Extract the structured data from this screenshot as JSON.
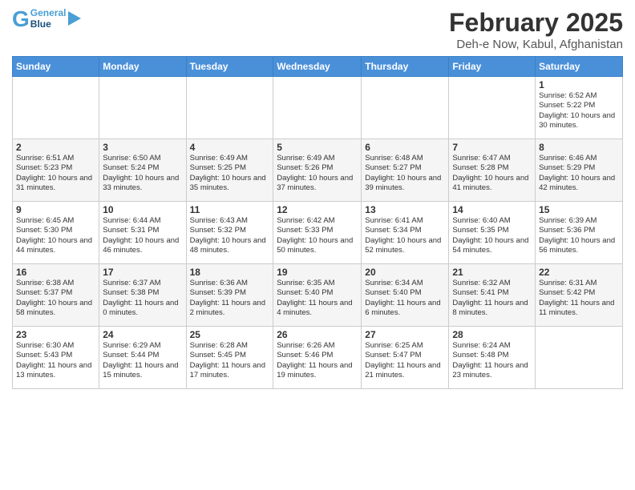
{
  "app": {
    "logo_general": "General",
    "logo_blue": "Blue",
    "title": "February 2025",
    "location": "Deh-e Now, Kabul, Afghanistan"
  },
  "calendar": {
    "headers": [
      "Sunday",
      "Monday",
      "Tuesday",
      "Wednesday",
      "Thursday",
      "Friday",
      "Saturday"
    ],
    "weeks": [
      {
        "days": [
          {
            "num": "",
            "info": ""
          },
          {
            "num": "",
            "info": ""
          },
          {
            "num": "",
            "info": ""
          },
          {
            "num": "",
            "info": ""
          },
          {
            "num": "",
            "info": ""
          },
          {
            "num": "",
            "info": ""
          },
          {
            "num": "1",
            "info": "Sunrise: 6:52 AM\nSunset: 5:22 PM\nDaylight: 10 hours and 30 minutes."
          }
        ]
      },
      {
        "days": [
          {
            "num": "2",
            "info": "Sunrise: 6:51 AM\nSunset: 5:23 PM\nDaylight: 10 hours and 31 minutes."
          },
          {
            "num": "3",
            "info": "Sunrise: 6:50 AM\nSunset: 5:24 PM\nDaylight: 10 hours and 33 minutes."
          },
          {
            "num": "4",
            "info": "Sunrise: 6:49 AM\nSunset: 5:25 PM\nDaylight: 10 hours and 35 minutes."
          },
          {
            "num": "5",
            "info": "Sunrise: 6:49 AM\nSunset: 5:26 PM\nDaylight: 10 hours and 37 minutes."
          },
          {
            "num": "6",
            "info": "Sunrise: 6:48 AM\nSunset: 5:27 PM\nDaylight: 10 hours and 39 minutes."
          },
          {
            "num": "7",
            "info": "Sunrise: 6:47 AM\nSunset: 5:28 PM\nDaylight: 10 hours and 41 minutes."
          },
          {
            "num": "8",
            "info": "Sunrise: 6:46 AM\nSunset: 5:29 PM\nDaylight: 10 hours and 42 minutes."
          }
        ]
      },
      {
        "days": [
          {
            "num": "9",
            "info": "Sunrise: 6:45 AM\nSunset: 5:30 PM\nDaylight: 10 hours and 44 minutes."
          },
          {
            "num": "10",
            "info": "Sunrise: 6:44 AM\nSunset: 5:31 PM\nDaylight: 10 hours and 46 minutes."
          },
          {
            "num": "11",
            "info": "Sunrise: 6:43 AM\nSunset: 5:32 PM\nDaylight: 10 hours and 48 minutes."
          },
          {
            "num": "12",
            "info": "Sunrise: 6:42 AM\nSunset: 5:33 PM\nDaylight: 10 hours and 50 minutes."
          },
          {
            "num": "13",
            "info": "Sunrise: 6:41 AM\nSunset: 5:34 PM\nDaylight: 10 hours and 52 minutes."
          },
          {
            "num": "14",
            "info": "Sunrise: 6:40 AM\nSunset: 5:35 PM\nDaylight: 10 hours and 54 minutes."
          },
          {
            "num": "15",
            "info": "Sunrise: 6:39 AM\nSunset: 5:36 PM\nDaylight: 10 hours and 56 minutes."
          }
        ]
      },
      {
        "days": [
          {
            "num": "16",
            "info": "Sunrise: 6:38 AM\nSunset: 5:37 PM\nDaylight: 10 hours and 58 minutes."
          },
          {
            "num": "17",
            "info": "Sunrise: 6:37 AM\nSunset: 5:38 PM\nDaylight: 11 hours and 0 minutes."
          },
          {
            "num": "18",
            "info": "Sunrise: 6:36 AM\nSunset: 5:39 PM\nDaylight: 11 hours and 2 minutes."
          },
          {
            "num": "19",
            "info": "Sunrise: 6:35 AM\nSunset: 5:40 PM\nDaylight: 11 hours and 4 minutes."
          },
          {
            "num": "20",
            "info": "Sunrise: 6:34 AM\nSunset: 5:40 PM\nDaylight: 11 hours and 6 minutes."
          },
          {
            "num": "21",
            "info": "Sunrise: 6:32 AM\nSunset: 5:41 PM\nDaylight: 11 hours and 8 minutes."
          },
          {
            "num": "22",
            "info": "Sunrise: 6:31 AM\nSunset: 5:42 PM\nDaylight: 11 hours and 11 minutes."
          }
        ]
      },
      {
        "days": [
          {
            "num": "23",
            "info": "Sunrise: 6:30 AM\nSunset: 5:43 PM\nDaylight: 11 hours and 13 minutes."
          },
          {
            "num": "24",
            "info": "Sunrise: 6:29 AM\nSunset: 5:44 PM\nDaylight: 11 hours and 15 minutes."
          },
          {
            "num": "25",
            "info": "Sunrise: 6:28 AM\nSunset: 5:45 PM\nDaylight: 11 hours and 17 minutes."
          },
          {
            "num": "26",
            "info": "Sunrise: 6:26 AM\nSunset: 5:46 PM\nDaylight: 11 hours and 19 minutes."
          },
          {
            "num": "27",
            "info": "Sunrise: 6:25 AM\nSunset: 5:47 PM\nDaylight: 11 hours and 21 minutes."
          },
          {
            "num": "28",
            "info": "Sunrise: 6:24 AM\nSunset: 5:48 PM\nDaylight: 11 hours and 23 minutes."
          },
          {
            "num": "",
            "info": ""
          }
        ]
      }
    ]
  }
}
